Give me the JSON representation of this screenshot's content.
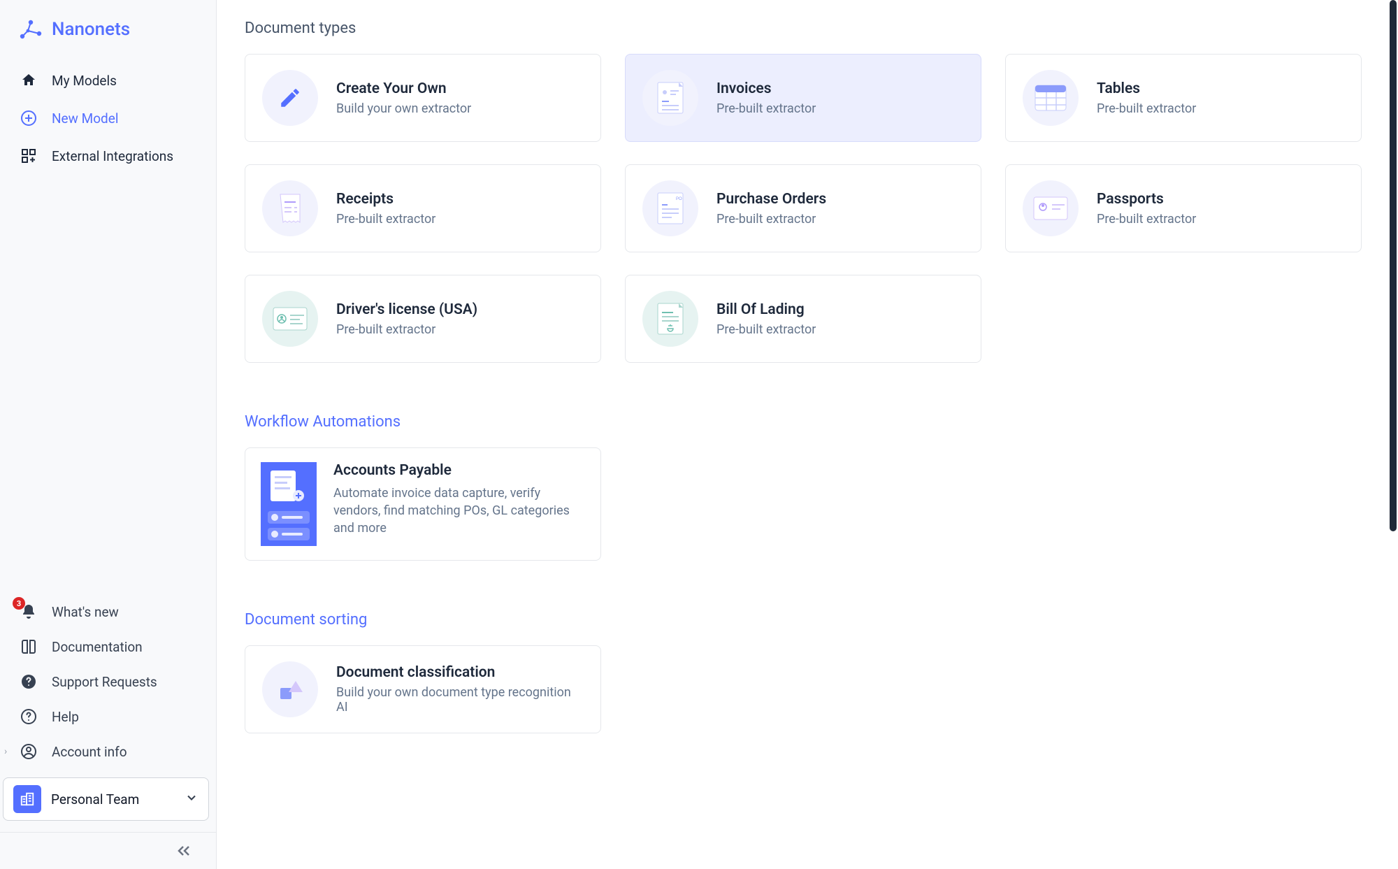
{
  "brand": {
    "name": "Nanonets"
  },
  "sidebar": {
    "top": [
      {
        "label": "My Models",
        "icon": "home"
      },
      {
        "label": "New Model",
        "icon": "plus-circle",
        "brand": true
      },
      {
        "label": "External Integrations",
        "icon": "grid-add"
      }
    ],
    "bottom": [
      {
        "label": "What's new",
        "icon": "bell",
        "badge": "3"
      },
      {
        "label": "Documentation",
        "icon": "book"
      },
      {
        "label": "Support Requests",
        "icon": "question-solid"
      },
      {
        "label": "Help",
        "icon": "question-outline"
      },
      {
        "label": "Account info",
        "icon": "user-circle",
        "caret": true
      }
    ],
    "team": {
      "label": "Personal Team"
    }
  },
  "sections": {
    "doc_types": {
      "title": "Document types",
      "cards": [
        {
          "title": "Create Your Own",
          "sub": "Build your own extractor",
          "icon": "pencil"
        },
        {
          "title": "Invoices",
          "sub": "Pre-built extractor",
          "icon": "doc-invoice",
          "active": true
        },
        {
          "title": "Tables",
          "sub": "Pre-built extractor",
          "icon": "doc-table"
        },
        {
          "title": "Receipts",
          "sub": "Pre-built extractor",
          "icon": "doc-receipt"
        },
        {
          "title": "Purchase Orders",
          "sub": "Pre-built extractor",
          "icon": "doc-po"
        },
        {
          "title": "Passports",
          "sub": "Pre-built extractor",
          "icon": "doc-passport"
        },
        {
          "title": "Driver's license (USA)",
          "sub": "Pre-built extractor",
          "icon": "doc-license",
          "teal": true
        },
        {
          "title": "Bill Of Lading",
          "sub": "Pre-built extractor",
          "icon": "doc-bol",
          "teal": true
        }
      ]
    },
    "workflow": {
      "title": "Workflow Automations",
      "cards": [
        {
          "title": "Accounts Payable",
          "desc": "Automate invoice data capture, verify vendors, find matching POs, GL categories and more"
        }
      ]
    },
    "sorting": {
      "title": "Document sorting",
      "cards": [
        {
          "title": "Document classification",
          "sub": "Build your own document type recognition AI",
          "icon": "shapes"
        }
      ]
    }
  }
}
